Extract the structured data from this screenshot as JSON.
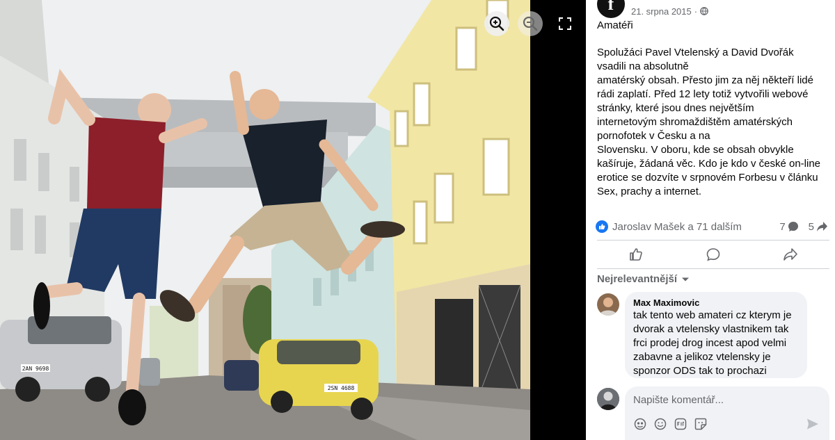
{
  "post": {
    "page_logo_letter": "f",
    "date": "21. srpna 2015",
    "separator": "·",
    "title": "Amatéři",
    "body_lines": [
      "Spolužáci Pavel Vtelenský a David Dvořák",
      "vsadili na absolutně",
      "amatérský obsah. Přesto jim za něj někteří lidé",
      "rádi zaplatí. Před 12 lety totiž vytvořili webové",
      "stránky, které jsou dnes největším",
      "internetovým shromaždištěm amatérských",
      "pornofotek v Česku a na",
      "Slovensku. V oboru, kde se obsah obvykle",
      "kašíruje, žádaná věc. Kdo je kdo v české on-line",
      "erotice se dozvíte v srpnovém Forbesu v článku",
      "Sex, prachy a internet."
    ]
  },
  "reactions": {
    "summary": "Jaroslav Mašek a 71 dalším",
    "comments_count": "7",
    "shares_count": "5"
  },
  "comments_section": {
    "sort_label": "Nejrelevantnější",
    "comment": {
      "author": "Max Maximovic",
      "text_lines": [
        "tak tento web amateri cz kterym je",
        "dvorak a vtelensky vlastnikem tak",
        "frci prodej drog incest apod velmi",
        "zabavne a jelikoz vtelensky je",
        "sponzor ODS tak to prochazi"
      ]
    },
    "composer_placeholder": "Napište komentář..."
  },
  "photo_overlay": {
    "front_plate": "2AN 9698",
    "yellow_plate": "2SN 4688"
  },
  "colors": {
    "facebook_blue": "#1877f2",
    "secondary_text": "#65676b",
    "bubble_bg": "#f0f2f5"
  },
  "icons": [
    "zoom-in-icon",
    "zoom-out-icon",
    "fullscreen-icon",
    "globe-icon",
    "like-badge-icon",
    "comment-count-icon",
    "share-count-icon",
    "like-icon",
    "comment-icon",
    "share-icon",
    "caret-down-icon",
    "emoji-icon",
    "gif-icon",
    "sticker-icon",
    "send-icon"
  ]
}
